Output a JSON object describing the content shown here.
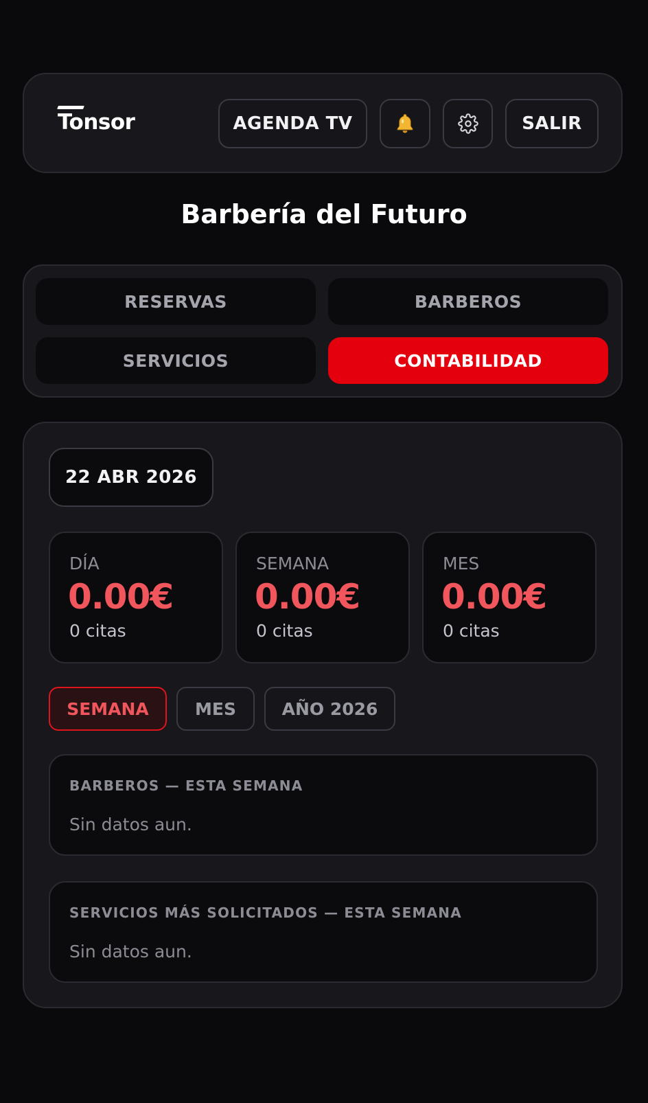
{
  "header": {
    "logo": "Tonsor",
    "agenda_label": "AGENDA TV",
    "bell_icon": "bell-icon",
    "gear_icon": "gear-icon",
    "salir_label": "SALIR"
  },
  "page_title": "Barbería del Futuro",
  "tabs": [
    {
      "label": "RESERVAS",
      "active": false
    },
    {
      "label": "BARBEROS",
      "active": false
    },
    {
      "label": "SERVICIOS",
      "active": false
    },
    {
      "label": "CONTABILIDAD",
      "active": true
    }
  ],
  "date_label": "22 ABR 2026",
  "stats": [
    {
      "label": "DÍA",
      "amount": "0.00€",
      "count": "0 citas"
    },
    {
      "label": "SEMANA",
      "amount": "0.00€",
      "count": "0 citas"
    },
    {
      "label": "MES",
      "amount": "0.00€",
      "count": "0 citas"
    }
  ],
  "period_filters": [
    {
      "label": "SEMANA",
      "active": true
    },
    {
      "label": "MES",
      "active": false
    },
    {
      "label": "AÑO 2026",
      "active": false
    }
  ],
  "panels": [
    {
      "heading": "BARBEROS — ESTA SEMANA",
      "empty": "Sin datos aun."
    },
    {
      "heading": "SERVICIOS MÁS SOLICITADOS — ESTA SEMANA",
      "empty": "Sin datos aun."
    }
  ],
  "colors": {
    "accent": "#e5000e",
    "amount": "#f0565c",
    "background": "#0a0a0c",
    "surface": "#18181c"
  }
}
